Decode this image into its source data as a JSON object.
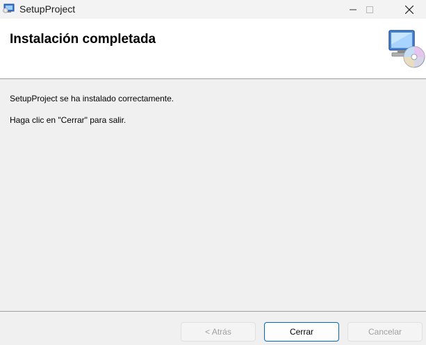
{
  "window": {
    "title": "SetupProject",
    "icons": {
      "app": "installer-icon",
      "minimize": "minimize-icon",
      "maximize": "maximize-icon",
      "close": "close-icon"
    }
  },
  "header": {
    "title": "Instalación completada",
    "icon": "computer-cd-icon"
  },
  "content": {
    "message_success": "SetupProject se ha instalado correctamente.",
    "message_instruction": "Haga clic en \"Cerrar\" para salir."
  },
  "buttons": {
    "back_label": "< Atrás",
    "close_label": "Cerrar",
    "cancel_label": "Cancelar"
  },
  "colors": {
    "accent": "#0067c0",
    "window_bg": "#f0f0f0",
    "header_bg": "#ffffff",
    "disabled_text": "#a0a0a0"
  }
}
